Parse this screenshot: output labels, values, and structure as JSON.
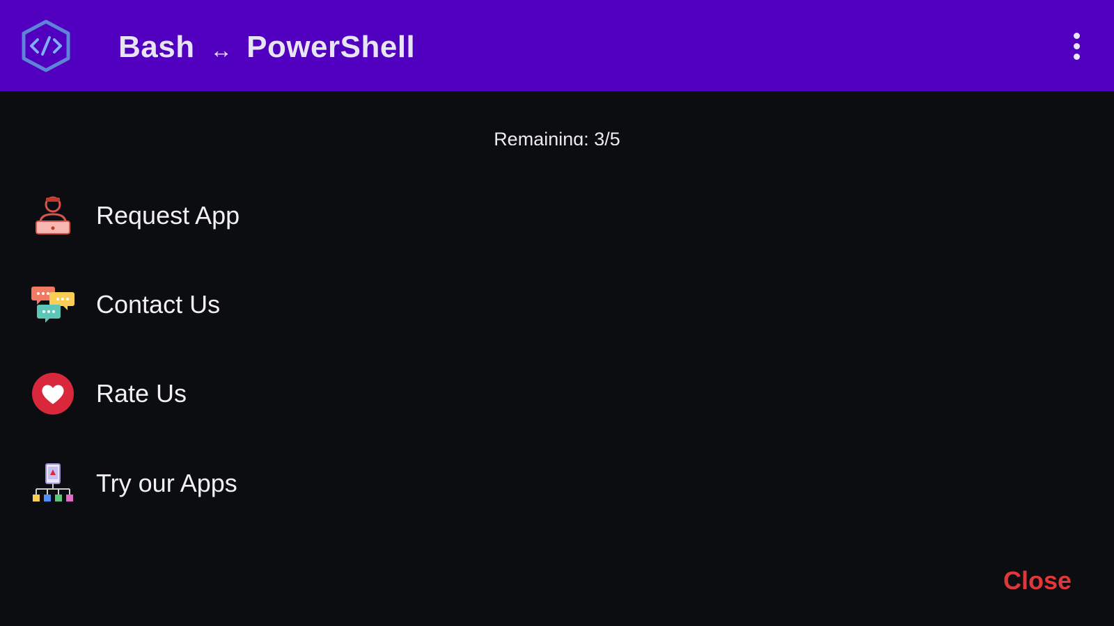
{
  "app": {
    "title_left": "Bash",
    "title_arrow": "↔",
    "title_right": "PowerShell",
    "accent_color": "#5000be",
    "background_color": "#0c0d11",
    "logo_icon": "code-hexagon-icon",
    "overflow_icon": "more-vertical-icon"
  },
  "dialog": {
    "remaining": "Remaining: 3/5",
    "items": [
      {
        "label": "Request App",
        "icon": "request-app-icon"
      },
      {
        "label": "Contact Us",
        "icon": "chat-bubbles-icon"
      },
      {
        "label": "Rate Us",
        "icon": "heart-icon"
      },
      {
        "label": "Try our Apps",
        "icon": "apps-network-icon"
      }
    ],
    "close_label": "Close",
    "close_color": "#e2373a"
  }
}
